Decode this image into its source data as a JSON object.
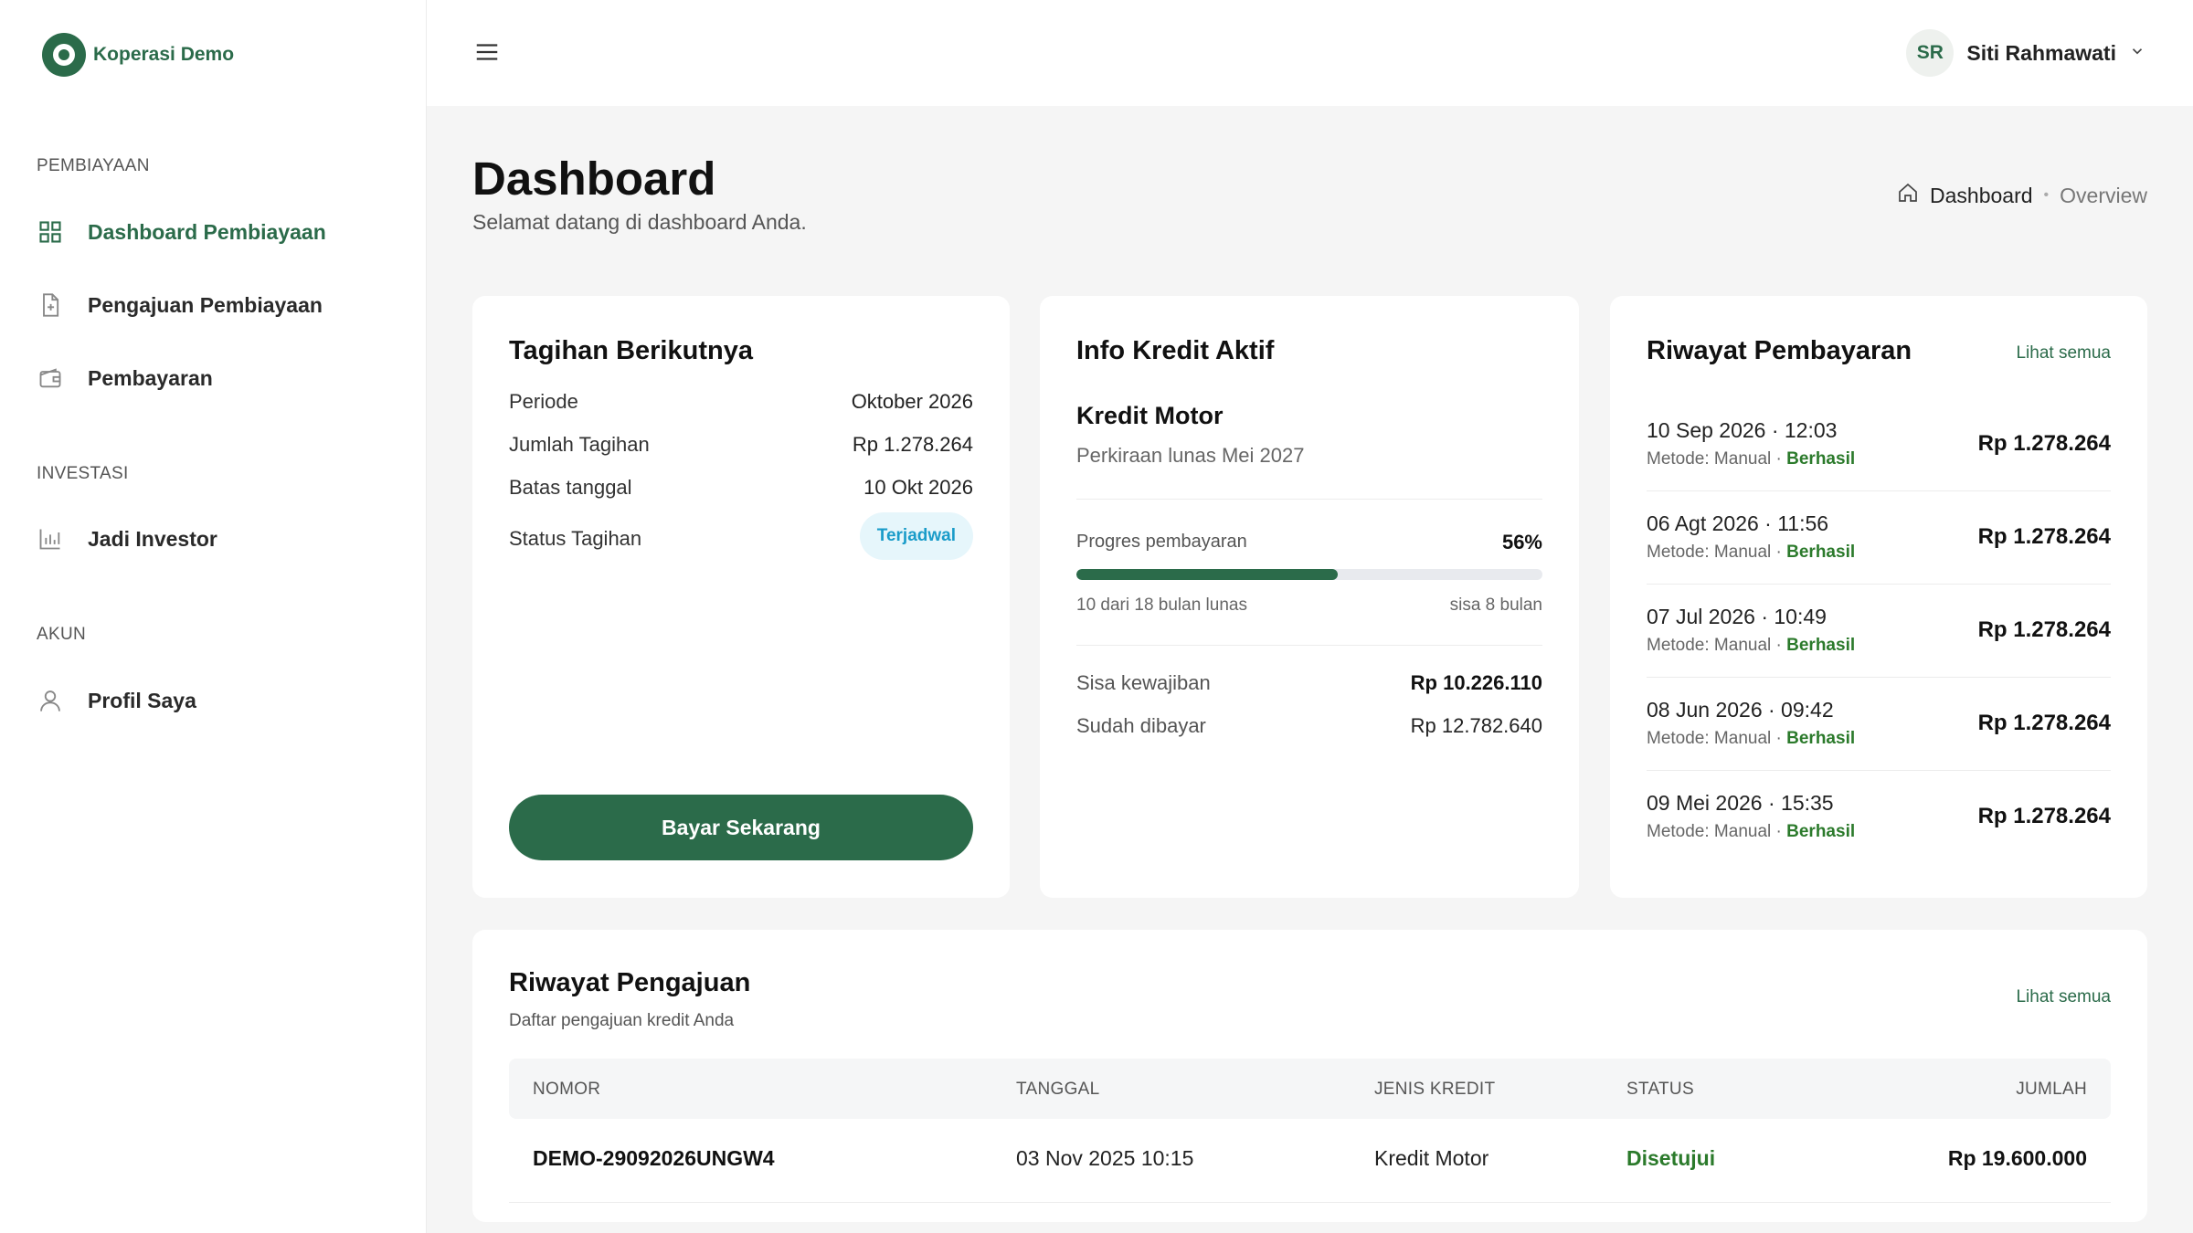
{
  "brand": {
    "name": "Koperasi Demo"
  },
  "sidebar": {
    "sections": [
      {
        "title": "PEMBIAYAAN",
        "items": [
          {
            "label": "Dashboard Pembiayaan",
            "icon": "grid-icon",
            "active": true
          },
          {
            "label": "Pengajuan Pembiayaan",
            "icon": "file-plus-icon"
          },
          {
            "label": "Pembayaran",
            "icon": "wallet-icon"
          }
        ]
      },
      {
        "title": "INVESTASI",
        "items": [
          {
            "label": "Jadi Investor",
            "icon": "bar-chart-icon"
          }
        ]
      },
      {
        "title": "AKUN",
        "items": [
          {
            "label": "Profil Saya",
            "icon": "user-icon"
          }
        ]
      }
    ]
  },
  "topbar": {
    "user_initials": "SR",
    "user_name": "Siti Rahmawati"
  },
  "page": {
    "title": "Dashboard",
    "subtitle": "Selamat datang di dashboard Anda.",
    "breadcrumb": {
      "current": "Dashboard",
      "last": "Overview"
    }
  },
  "next_bill": {
    "title": "Tagihan Berikutnya",
    "rows": [
      {
        "label": "Periode",
        "value": "Oktober 2026"
      },
      {
        "label": "Jumlah Tagihan",
        "value": "Rp 1.278.264"
      },
      {
        "label": "Batas tanggal",
        "value": "10 Okt 2026"
      }
    ],
    "status_label": "Status Tagihan",
    "status_value": "Terjadwal",
    "pay_button": "Bayar Sekarang"
  },
  "credit_info": {
    "title": "Info Kredit Aktif",
    "product": "Kredit Motor",
    "estimate": "Perkiraan lunas Mei 2027",
    "progress_label": "Progres pembayaran",
    "progress_percent_text": "56%",
    "progress_fraction": 0.56,
    "paid_months": "10 dari 18 bulan lunas",
    "remaining_months": "sisa 8 bulan",
    "remaining_label": "Sisa kewajiban",
    "remaining_value": "Rp 10.226.110",
    "paid_label": "Sudah dibayar",
    "paid_value": "Rp 12.782.640"
  },
  "payment_history": {
    "title": "Riwayat Pembayaran",
    "see_all": "Lihat semua",
    "items": [
      {
        "date": "10 Sep 2026 · 12:03",
        "method": "Metode: Manual · ",
        "status": "Berhasil",
        "amount": "Rp 1.278.264"
      },
      {
        "date": "06 Agt 2026 · 11:56",
        "method": "Metode: Manual · ",
        "status": "Berhasil",
        "amount": "Rp 1.278.264"
      },
      {
        "date": "07 Jul 2026 · 10:49",
        "method": "Metode: Manual · ",
        "status": "Berhasil",
        "amount": "Rp 1.278.264"
      },
      {
        "date": "08 Jun 2026 · 09:42",
        "method": "Metode: Manual · ",
        "status": "Berhasil",
        "amount": "Rp 1.278.264"
      },
      {
        "date": "09 Mei 2026 · 15:35",
        "method": "Metode: Manual · ",
        "status": "Berhasil",
        "amount": "Rp 1.278.264"
      }
    ]
  },
  "applications": {
    "title": "Riwayat Pengajuan",
    "subtitle": "Daftar pengajuan kredit Anda",
    "see_all": "Lihat semua",
    "columns": [
      "NOMOR",
      "TANGGAL",
      "JENIS KREDIT",
      "STATUS",
      "JUMLAH"
    ],
    "rows": [
      {
        "nomor": "DEMO-29092026UNGW4",
        "tanggal": "03 Nov 2025 10:15",
        "jenis": "Kredit Motor",
        "status": "Disetujui",
        "jumlah": "Rp 19.600.000"
      }
    ]
  },
  "colors": {
    "primary": "#2b6b4a",
    "success": "#2b7a2b",
    "info": "#1a9cc9",
    "background": "#f5f5f5"
  }
}
